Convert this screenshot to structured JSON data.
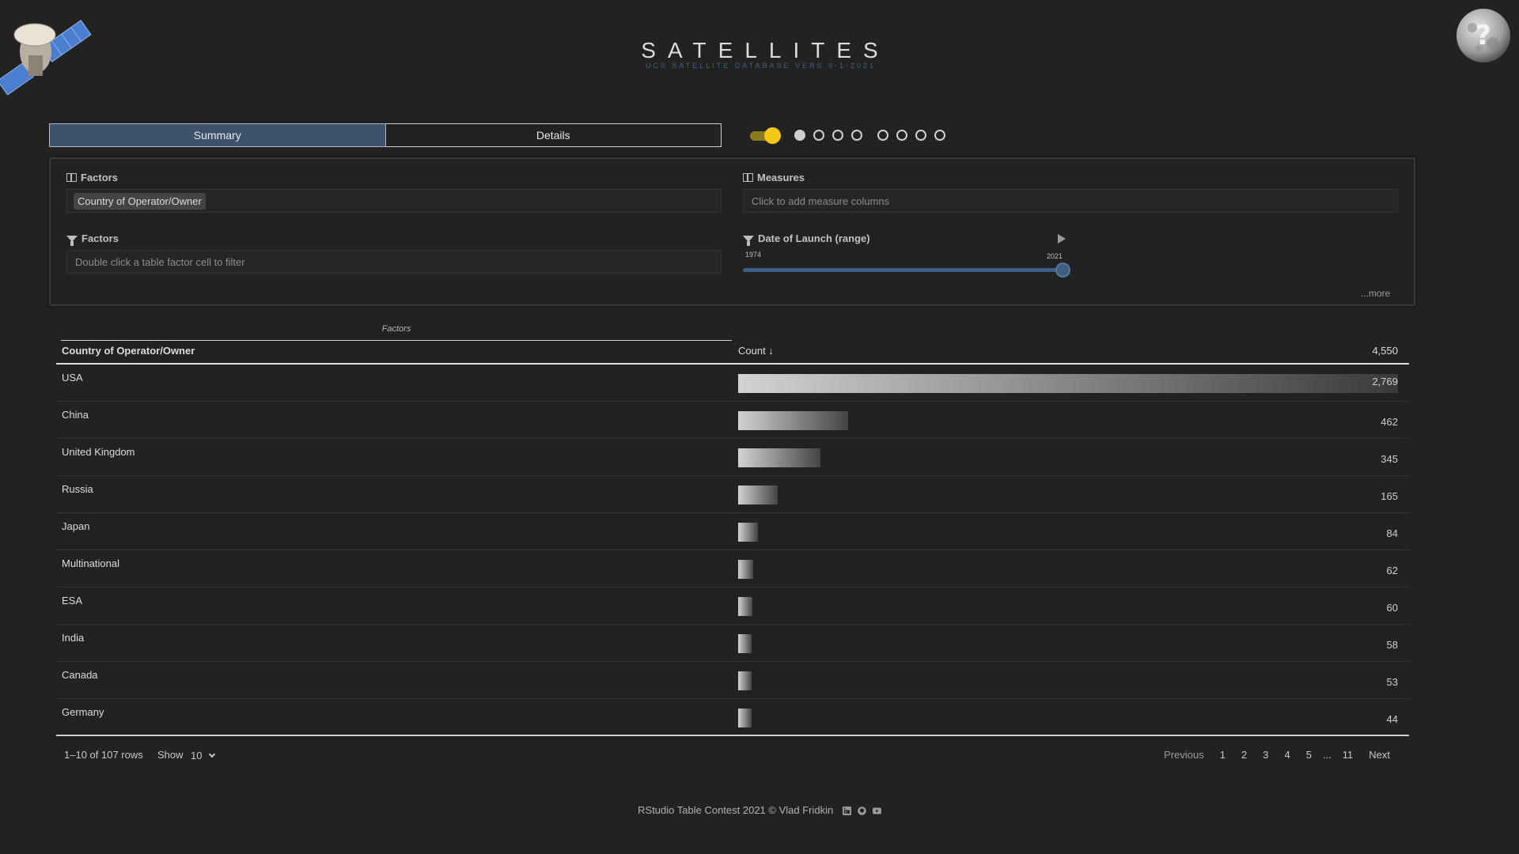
{
  "header": {
    "title": "SATELLITES",
    "subtitle": "UCS SATELLITE DATABASE VERS 9-1-2021"
  },
  "tabs": [
    {
      "label": "Summary",
      "active": true
    },
    {
      "label": "Details",
      "active": false
    }
  ],
  "theme_toggle": {
    "on": true,
    "color": "#f3c716"
  },
  "page_dots": {
    "count": 8,
    "selected_index": 0
  },
  "panel": {
    "factors_group_label": "Factors",
    "factors_group_chip": "Country of Operator/Owner",
    "measures_label": "Measures",
    "measures_placeholder": "Click to add measure columns",
    "filter_label": "Factors",
    "filter_placeholder": "Double click a table factor cell to filter",
    "date_filter_label": "Date of Launch (range)",
    "date_min": "1974",
    "date_max": "2021",
    "more_label": "...more"
  },
  "table": {
    "group_header": "Factors",
    "col_factor": "Country of Operator/Owner",
    "col_count": "Count ↓",
    "total": "4,550",
    "rows": [
      {
        "name": "USA",
        "count": 2769,
        "display": "2,769"
      },
      {
        "name": "China",
        "count": 462,
        "display": "462"
      },
      {
        "name": "United Kingdom",
        "count": 345,
        "display": "345"
      },
      {
        "name": "Russia",
        "count": 165,
        "display": "165"
      },
      {
        "name": "Japan",
        "count": 84,
        "display": "84"
      },
      {
        "name": "Multinational",
        "count": 62,
        "display": "62"
      },
      {
        "name": "ESA",
        "count": 60,
        "display": "60"
      },
      {
        "name": "India",
        "count": 58,
        "display": "58"
      },
      {
        "name": "Canada",
        "count": 53,
        "display": "53"
      },
      {
        "name": "Germany",
        "count": 44,
        "display": "44"
      }
    ]
  },
  "pagination": {
    "rows_info": "1–10 of 107 rows",
    "show_label": "Show",
    "page_size": "10",
    "previous": "Previous",
    "pages": [
      "1",
      "2",
      "3",
      "4",
      "5"
    ],
    "ellipsis": "...",
    "last_page": "11",
    "next": "Next"
  },
  "footer": {
    "credit": "RStudio Table Contest 2021 © Vlad Fridkin",
    "icons": [
      "linkedin-icon",
      "github-icon",
      "youtube-icon"
    ]
  },
  "colors": {
    "background": "#222222",
    "accent_blue": "#3f5f82",
    "tab_active": "#3e526b",
    "toggle_yellow": "#f3c716"
  }
}
